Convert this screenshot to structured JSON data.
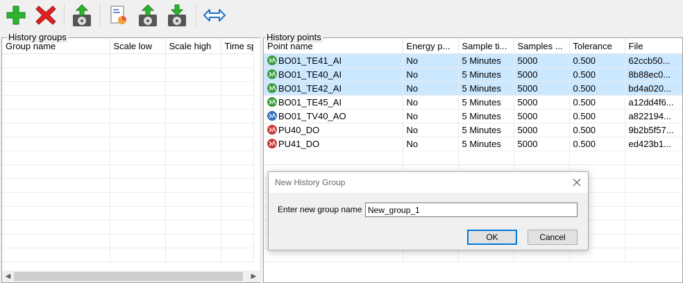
{
  "toolbar": {
    "icons": [
      "add-icon",
      "delete-icon",
      "upload-disk-icon",
      "report-icon",
      "export-disk-icon",
      "import-disk-icon",
      "swap-arrows-icon"
    ]
  },
  "history_groups": {
    "label": "History groups",
    "columns": [
      "Group name",
      "Scale low",
      "Scale high",
      "Time sp"
    ]
  },
  "history_points": {
    "label": "History points",
    "columns": [
      "Point name",
      "Energy p...",
      "Sample ti...",
      "Samples ...",
      "Tolerance",
      "File"
    ],
    "rows": [
      {
        "type": "AI",
        "icon_color": "#3c9b3c",
        "name": "BO01_TE41_AI",
        "energy": "No",
        "sample_time": "5 Minutes",
        "samples": "5000",
        "tolerance": "0.500",
        "file": "62ccb50...",
        "selected": true
      },
      {
        "type": "AI",
        "icon_color": "#3c9b3c",
        "name": "BO01_TE40_AI",
        "energy": "No",
        "sample_time": "5 Minutes",
        "samples": "5000",
        "tolerance": "0.500",
        "file": "8b88ec0...",
        "selected": true
      },
      {
        "type": "AI",
        "icon_color": "#3c9b3c",
        "name": "BO01_TE42_AI",
        "energy": "No",
        "sample_time": "5 Minutes",
        "samples": "5000",
        "tolerance": "0.500",
        "file": "bd4a020...",
        "selected": true
      },
      {
        "type": "AI",
        "icon_color": "#3c9b3c",
        "name": "BO01_TE45_AI",
        "energy": "No",
        "sample_time": "5 Minutes",
        "samples": "5000",
        "tolerance": "0.500",
        "file": "a12dd4f6...",
        "selected": false
      },
      {
        "type": "AO",
        "icon_color": "#2f6fc0",
        "name": "BO01_TV40_AO",
        "energy": "No",
        "sample_time": "5 Minutes",
        "samples": "5000",
        "tolerance": "0.500",
        "file": "a822194...",
        "selected": false
      },
      {
        "type": "DO",
        "icon_color": "#c83a3a",
        "name": "PU40_DO",
        "energy": "No",
        "sample_time": "5 Minutes",
        "samples": "5000",
        "tolerance": "0.500",
        "file": "9b2b5f57...",
        "selected": false
      },
      {
        "type": "DO",
        "icon_color": "#c83a3a",
        "name": "PU41_DO",
        "energy": "No",
        "sample_time": "5 Minutes",
        "samples": "5000",
        "tolerance": "0.500",
        "file": "ed423b1...",
        "selected": false
      }
    ]
  },
  "dialog": {
    "title": "New History Group",
    "prompt": "Enter new group name",
    "value": "New_group_1",
    "ok_label": "OK",
    "cancel_label": "Cancel"
  }
}
